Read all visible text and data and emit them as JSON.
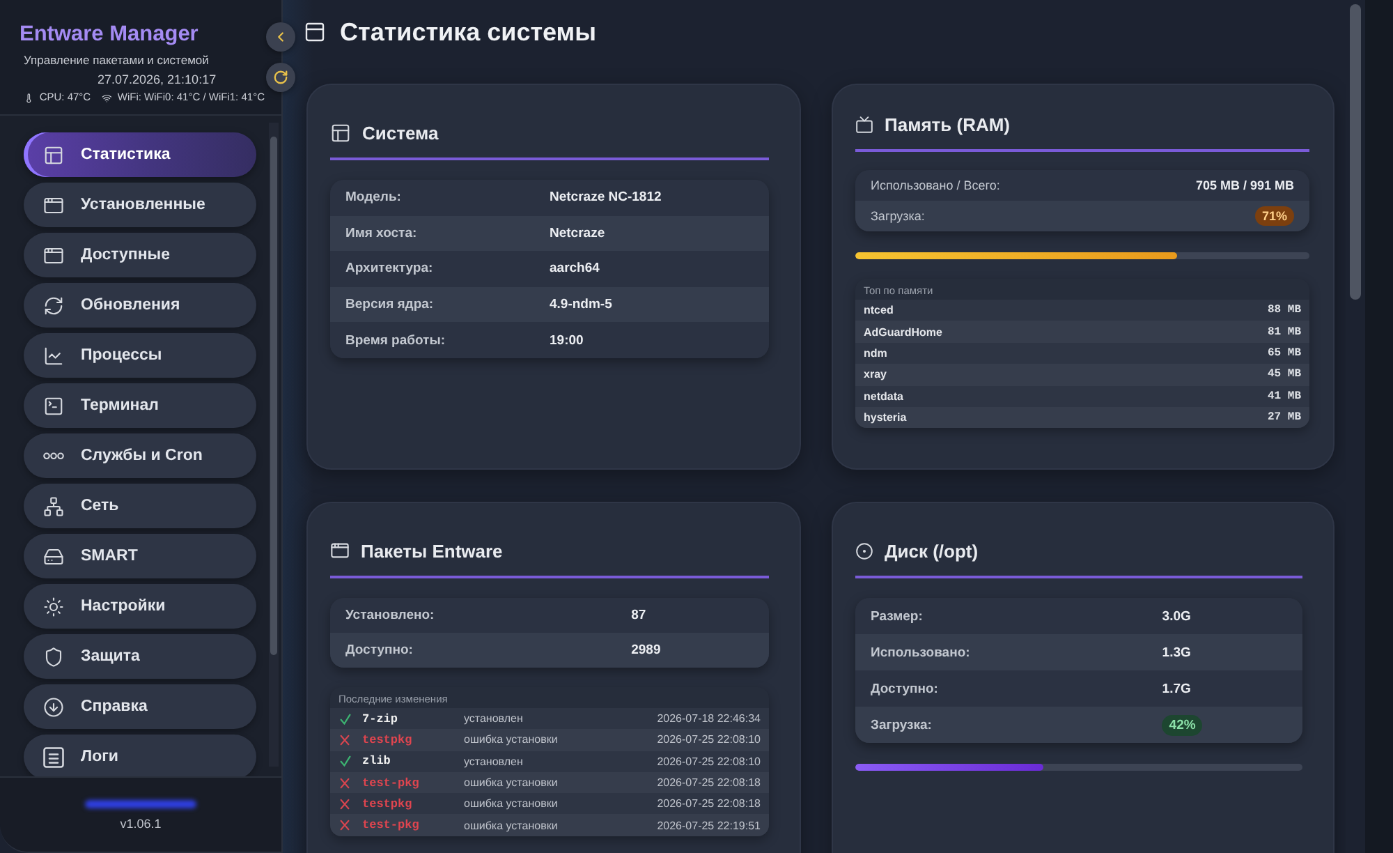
{
  "sidebar": {
    "title": "Entware Manager",
    "subtitle": "Управление пакетами и системой",
    "datetime": "27.07.2026, 21:10:17",
    "cpu_temp": "CPU: 47°C",
    "wifi_temp": "WiFi: WiFi0: 41°C / WiFi1: 41°C",
    "nav": [
      {
        "label": "Статистика",
        "selected": true
      },
      {
        "label": "Установленные",
        "selected": false
      },
      {
        "label": "Доступные",
        "selected": false
      },
      {
        "label": "Обновления",
        "selected": false
      },
      {
        "label": "Процессы",
        "selected": false
      },
      {
        "label": "Терминал",
        "selected": false
      },
      {
        "label": "Службы и Cron",
        "selected": false
      },
      {
        "label": "Сеть",
        "selected": false
      },
      {
        "label": "SMART",
        "selected": false
      },
      {
        "label": "Настройки",
        "selected": false
      },
      {
        "label": "Защита",
        "selected": false
      },
      {
        "label": "Справка",
        "selected": false
      },
      {
        "label": "Логи",
        "selected": false
      }
    ],
    "version": "v1.06.1"
  },
  "page": {
    "title": "Статистика системы"
  },
  "system": {
    "title": "Система",
    "rows": [
      {
        "label": "Модель:",
        "value": "Netcraze NC-1812"
      },
      {
        "label": "Имя хоста:",
        "value": "Netcraze"
      },
      {
        "label": "Архитектура:",
        "value": "aarch64"
      },
      {
        "label": "Версия ядра:",
        "value": "4.9-ndm-5"
      },
      {
        "label": "Время работы:",
        "value": "19:00"
      }
    ]
  },
  "memory": {
    "title": "Память (RAM)",
    "rows": [
      {
        "label": "Использовано / Всего:",
        "value": "705 MB / 991 MB",
        "kind": "text"
      },
      {
        "label": "Загрузка:",
        "value": "71%",
        "kind": "badge"
      }
    ],
    "bar": {
      "level": 0.71
    },
    "top_title": "Топ по памяти",
    "top": [
      {
        "name": "ntced",
        "value": "88 MB"
      },
      {
        "name": "AdGuardHome",
        "value": "81 MB"
      },
      {
        "name": "ndm",
        "value": "65 MB"
      },
      {
        "name": "xray",
        "value": "45 MB"
      },
      {
        "name": "netdata",
        "value": "41 MB"
      },
      {
        "name": "hysteria",
        "value": "27 MB"
      }
    ]
  },
  "packages": {
    "title": "Пакеты Entware",
    "rows": [
      {
        "label": "Установлено:",
        "value": "87"
      },
      {
        "label": "Доступно:",
        "value": "2989"
      }
    ],
    "log_title": "Последние изменения",
    "log": [
      {
        "kind": "success",
        "name": "7-zip",
        "status": "установлен",
        "time": "2026-07-18 22:46:34"
      },
      {
        "kind": "error",
        "name": "testpkg",
        "status": "ошибка установки",
        "time": "2026-07-25 22:08:10"
      },
      {
        "kind": "success",
        "name": "zlib",
        "status": "установлен",
        "time": "2026-07-25 22:08:10"
      },
      {
        "kind": "error",
        "name": "test-pkg",
        "status": "ошибка установки",
        "time": "2026-07-25 22:08:18"
      },
      {
        "kind": "error",
        "name": "testpkg",
        "status": "ошибка установки",
        "time": "2026-07-25 22:08:18"
      },
      {
        "kind": "error",
        "name": "test-pkg",
        "status": "ошибка установки",
        "time": "2026-07-25 22:19:51"
      }
    ]
  },
  "disk": {
    "title": "Диск (/opt)",
    "rows": [
      {
        "label": "Размер:",
        "value": "3.0G",
        "kind": "text"
      },
      {
        "label": "Использовано:",
        "value": "1.3G",
        "kind": "text"
      },
      {
        "label": "Доступно:",
        "value": "1.7G",
        "kind": "text"
      },
      {
        "label": "Загрузка:",
        "value": "42%",
        "kind": "badge"
      }
    ],
    "bar": {
      "level": 0.42
    }
  }
}
